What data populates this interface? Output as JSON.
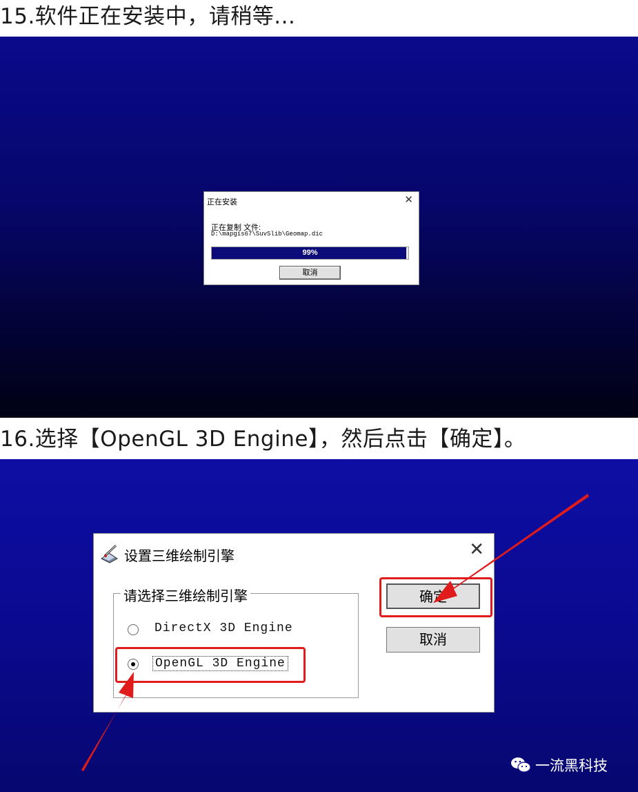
{
  "step15": {
    "heading": "15.软件正在安装中，请稍等...",
    "dialog": {
      "title": "正在安装",
      "close_glyph": "✕",
      "status_text": "正在复制 文件:",
      "file_path": "D:\\mapgis67\\SuvSlib\\Geomap.dic",
      "progress_percent": 99,
      "progress_label": "99%",
      "cancel_label": "取消"
    }
  },
  "step16": {
    "heading": "16.选择【OpenGL 3D Engine】，然后点击【确定】。",
    "dialog": {
      "title": "设置三维绘制引擎",
      "close_glyph": "✕",
      "app_icon": "paint-pen-icon",
      "group_label": "请选择三维绘制引擎",
      "options": [
        {
          "label": "DirectX 3D Engine",
          "selected": false
        },
        {
          "label": "OpenGL  3D Engine",
          "selected": true
        }
      ],
      "ok_label": "确定",
      "cancel_label": "取消"
    },
    "annotation_color": "#e01b1b"
  },
  "watermark": {
    "icon": "wechat-icon",
    "text": "一流黑科技"
  }
}
